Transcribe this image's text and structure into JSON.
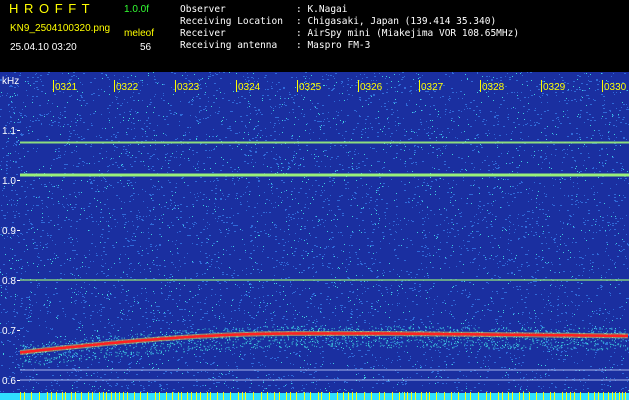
{
  "header": {
    "app_name": "H R O F F T",
    "version": "1.0.0f",
    "filename": "KN9_2504100320.png",
    "meleof_label": "meleof",
    "meleof_value": "56",
    "datetime": "25.04.10 03:20",
    "info": [
      {
        "label": "Observer",
        "value": ": K.Nagai"
      },
      {
        "label": "Receiving Location",
        "value": ": Chigasaki, Japan (139.414 35.340)"
      },
      {
        "label": "Receiver",
        "value": ": AirSpy mini (Miakejima VOR 108.65MHz)"
      },
      {
        "label": "Receiving antenna",
        "value": ": Maspro FM-3"
      }
    ]
  },
  "spectrogram": {
    "y_unit": "kHz",
    "y_ticks": [
      "1.1",
      "1.0",
      "0.9",
      "0.8",
      "0.7",
      "0.6"
    ],
    "time_labels": [
      "0321",
      "0322",
      "0323",
      "0324",
      "0325",
      "0326",
      "0327",
      "0328",
      "0329",
      "0330"
    ],
    "colors": {
      "background": "#1a2fa0",
      "noise_a": "#2f6ad8",
      "noise_b": "#3fd0e0",
      "line_green": "#9af07a",
      "trace_red": "#ff2020",
      "label_yellow": "#ffff00"
    }
  }
}
